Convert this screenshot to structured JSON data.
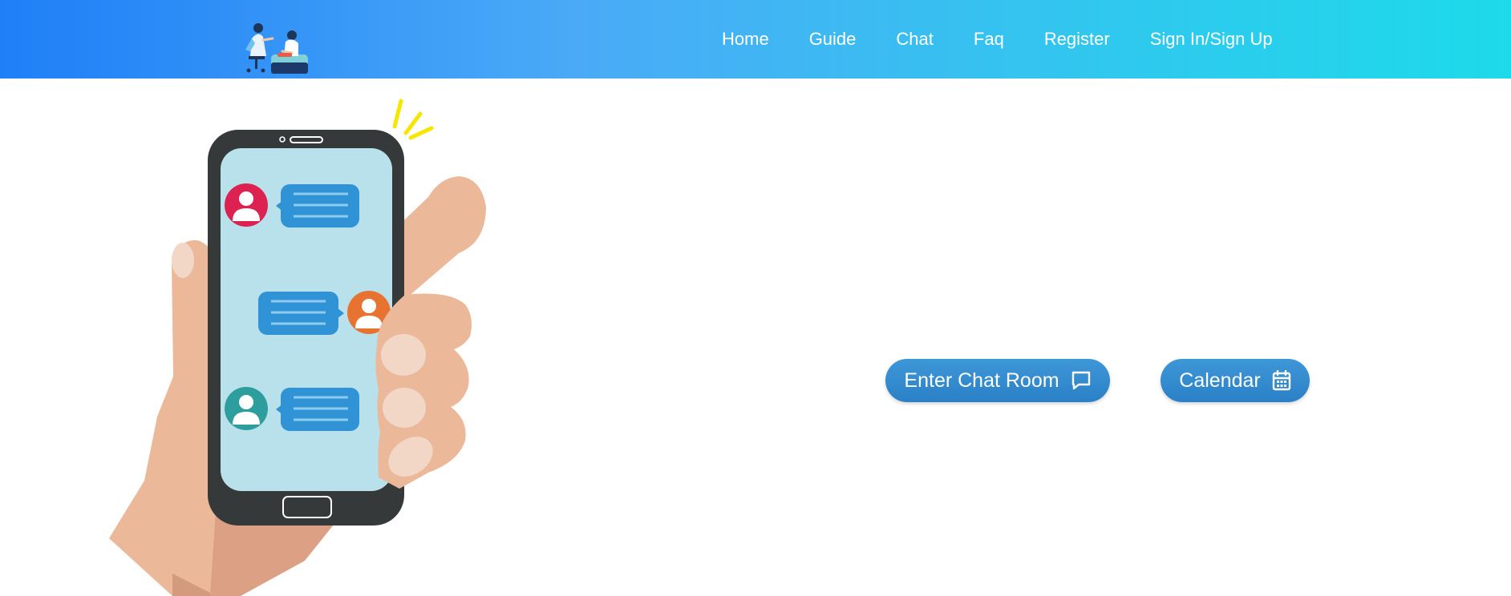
{
  "navbar": {
    "logo_icon": "counseling-illustration-logo",
    "links": [
      {
        "label": "Home"
      },
      {
        "label": "Guide"
      },
      {
        "label": "Chat"
      },
      {
        "label": "Faq"
      },
      {
        "label": "Register"
      },
      {
        "label": "Sign In/Sign Up"
      }
    ]
  },
  "hero": {
    "illustration_icon": "hand-holding-phone-chat-illustration"
  },
  "actions": {
    "enter_chat_label": "Enter Chat Room",
    "enter_chat_icon": "chat-bubble-icon",
    "calendar_label": "Calendar",
    "calendar_icon": "calendar-icon"
  },
  "colors": {
    "nav_gradient_start": "#1f7ff7",
    "nav_gradient_end": "#1ddaea",
    "button_blue": "#2f86c9"
  }
}
